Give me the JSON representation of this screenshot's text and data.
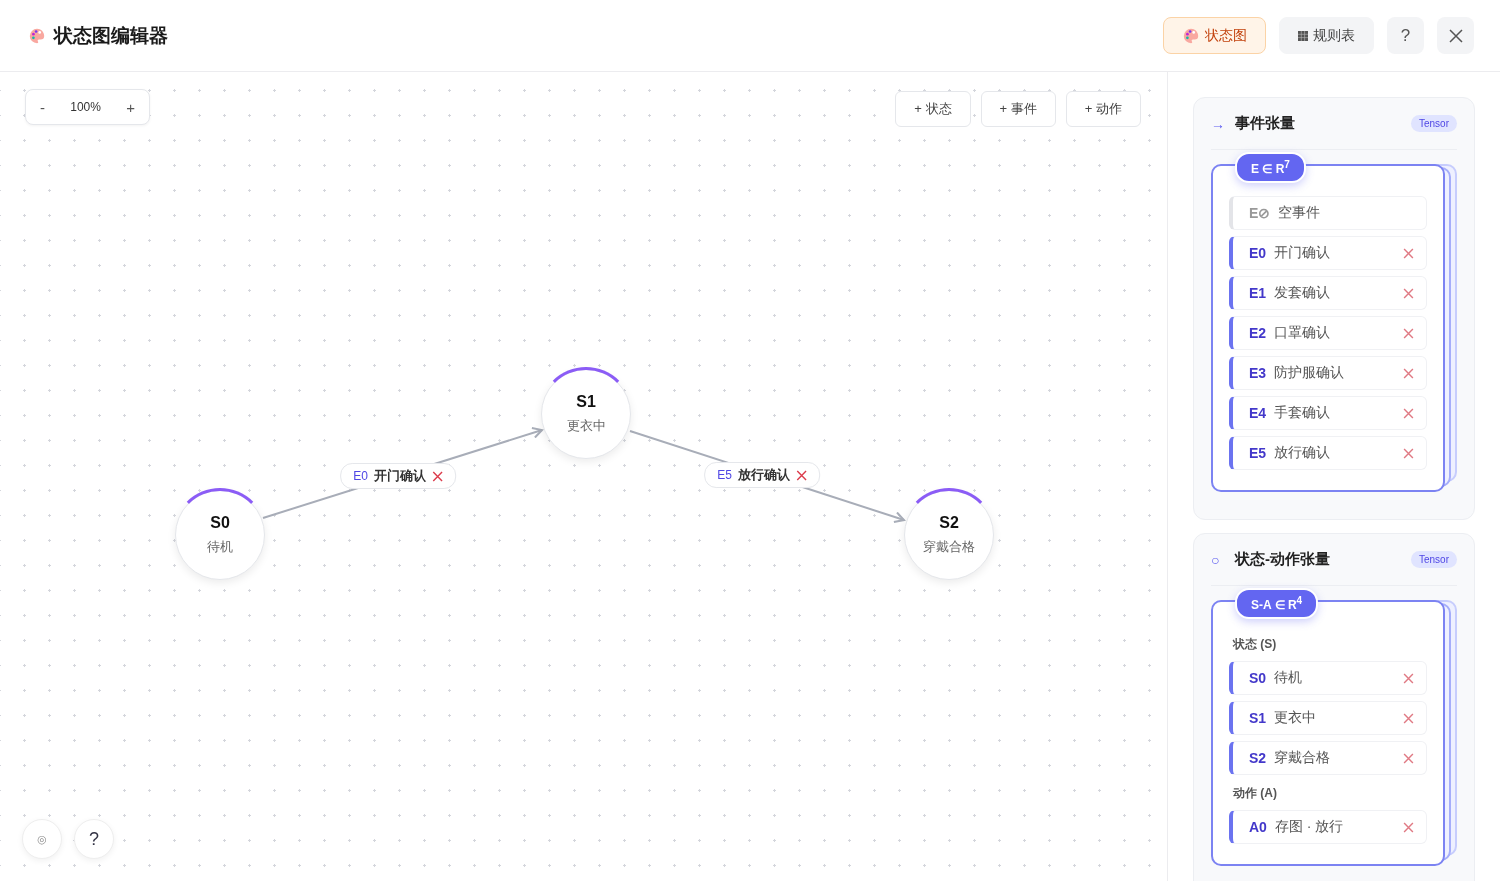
{
  "header": {
    "title": "状态图编辑器",
    "tabs": [
      {
        "label": "状态图",
        "kind": "diagram",
        "selected": true
      },
      {
        "label": "规则表",
        "kind": "table",
        "selected": false
      }
    ],
    "help": "?"
  },
  "canvas": {
    "zoom": {
      "minus": "-",
      "value": "100%",
      "plus": "+"
    },
    "toolbar": [
      "+ 状态",
      "+ 事件",
      "+ 动作"
    ],
    "nodes": [
      {
        "code": "S0",
        "name": "待机"
      },
      {
        "code": "S1",
        "name": "更衣中"
      },
      {
        "code": "S2",
        "name": "穿戴合格"
      }
    ],
    "edges": [
      {
        "code": "E0",
        "name": "开门确认"
      },
      {
        "code": "E5",
        "name": "放行确认"
      }
    ],
    "corner_buttons": [
      "◎",
      "?"
    ]
  },
  "panel": {
    "sections": [
      {
        "icon": "→",
        "title": "事件张量",
        "tag": "Tensor",
        "badge": "E ∈ R$^{7}$",
        "groups": [
          {
            "items": [
              {
                "kind": "empty",
                "code": "E⊘",
                "name": "空事件"
              },
              {
                "kind": "item",
                "code": "E0",
                "name": "开门确认"
              },
              {
                "kind": "item",
                "code": "E1",
                "name": "发套确认"
              },
              {
                "kind": "item",
                "code": "E2",
                "name": "口罩确认"
              },
              {
                "kind": "item",
                "code": "E3",
                "name": "防护服确认"
              },
              {
                "kind": "item",
                "code": "E4",
                "name": "手套确认"
              },
              {
                "kind": "item",
                "code": "E5",
                "name": "放行确认"
              }
            ]
          }
        ]
      },
      {
        "icon": "○",
        "title": "状态-动作张量",
        "tag": "Tensor",
        "badge": "S-A ∈ R$^{4}$",
        "groups": [
          {
            "label": "状态 (S)",
            "items": [
              {
                "kind": "item",
                "code": "S0",
                "name": "待机"
              },
              {
                "kind": "item",
                "code": "S1",
                "name": "更衣中"
              },
              {
                "kind": "item",
                "code": "S2",
                "name": "穿戴合格"
              }
            ]
          },
          {
            "label": "动作 (A)",
            "items": [
              {
                "kind": "item",
                "code": "A0",
                "name": "存图 · 放行"
              }
            ]
          }
        ]
      }
    ]
  }
}
